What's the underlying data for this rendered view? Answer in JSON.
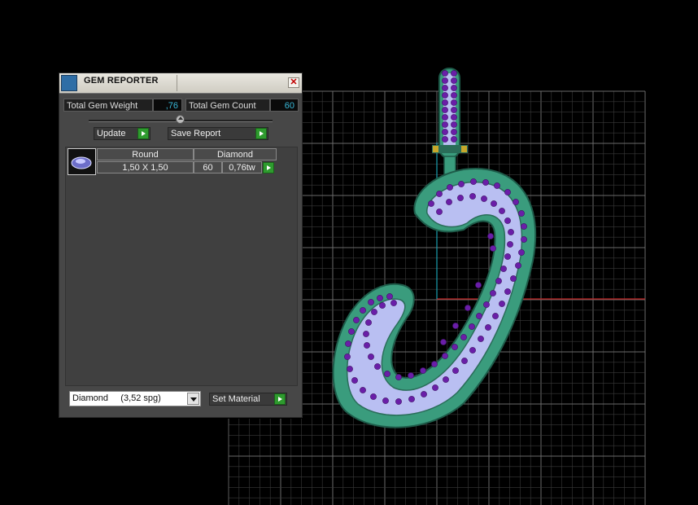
{
  "panel": {
    "title": "GEM REPORTER",
    "total_weight_label": "Total Gem Weight",
    "total_weight_value": ",76",
    "total_count_label": "Total Gem Count",
    "total_count_value": "60",
    "update_label": "Update",
    "save_report_label": "Save Report",
    "gem_row": {
      "shape": "Round",
      "material": "Diamond",
      "size": "1,50 X 1,50",
      "count": "60",
      "weight": "0,76tw"
    },
    "material_select": "Diamond     (3,52 spg)",
    "set_material_label": "Set Material"
  },
  "colors": {
    "panel_bg": "#474747",
    "value_text": "#38b8d8",
    "button_green": "#2e9b2e",
    "metal_green": "#3a9c7d",
    "stone_fill": "#b9bff2",
    "gem_purple": "#6a1ea8",
    "axis_red": "#c02020",
    "axis_cyan": "#1aa0b0",
    "grid_line": "#5a5a5a"
  }
}
